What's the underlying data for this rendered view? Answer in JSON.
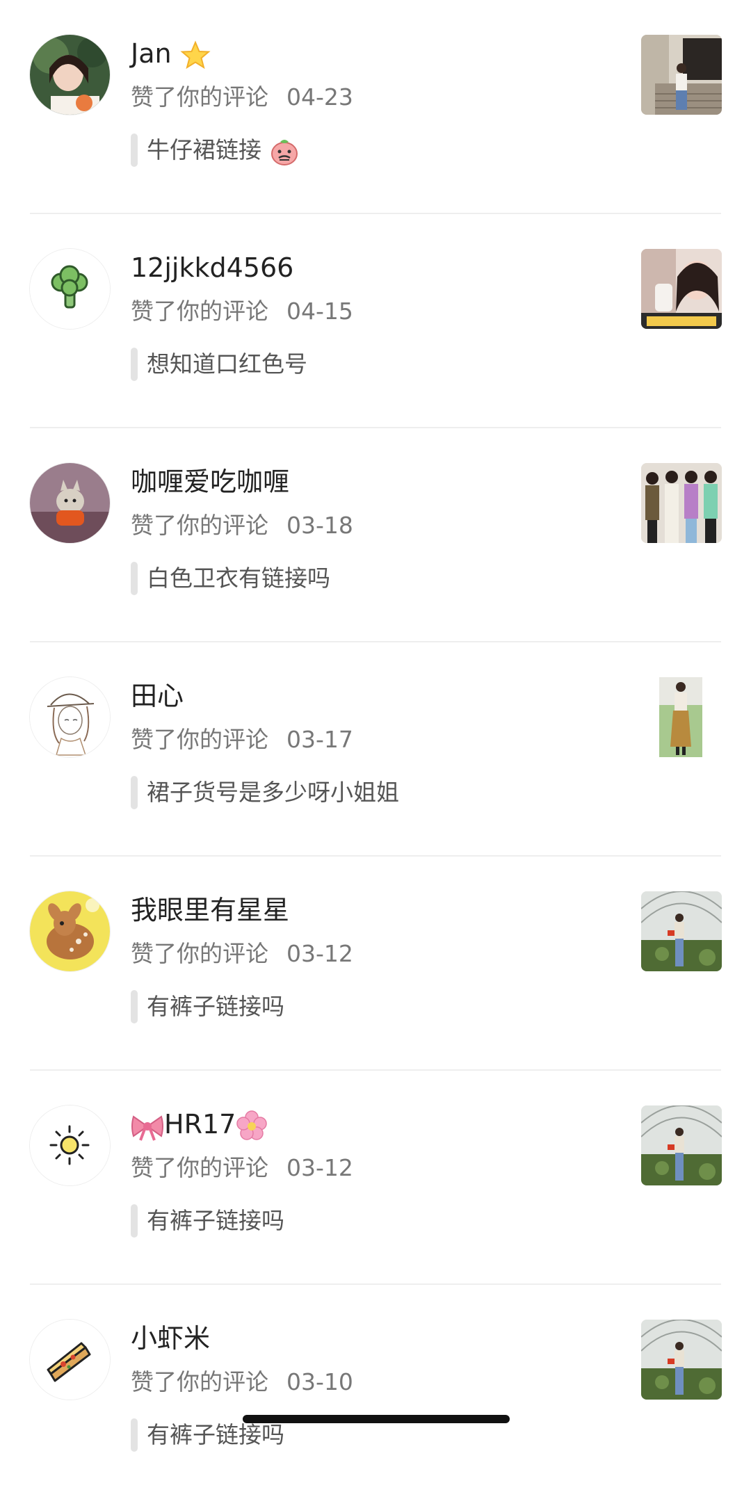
{
  "notifications": [
    {
      "name": "Jan",
      "name_emoji_after": "star-emoji",
      "action": "赞了你的评论",
      "date": "04-23",
      "comment": "牛仔裙链接",
      "comment_emoji": "peach-face-emoji",
      "avatar": "girl-photo-avatar",
      "thumbnail": "storefront-photo"
    },
    {
      "name": "12jjkkd4566",
      "action": "赞了你的评论",
      "date": "04-15",
      "comment": "想知道口红色号",
      "avatar": "broccoli-icon-avatar",
      "thumbnail": "woman-selfie-photo"
    },
    {
      "name": "咖喱爱吃咖喱",
      "action": "赞了你的评论",
      "date": "03-18",
      "comment": "白色卫衣有链接吗",
      "avatar": "cartoon-cat-avatar",
      "thumbnail": "four-women-photo"
    },
    {
      "name": "田心",
      "action": "赞了你的评论",
      "date": "03-17",
      "comment": "裙子货号是多少呀小姐姐",
      "avatar": "sketch-girl-avatar",
      "thumbnail": "woman-dress-photo"
    },
    {
      "name": "我眼里有星星",
      "action": "赞了你的评论",
      "date": "03-12",
      "comment": "有裤子链接吗",
      "avatar": "deer-cartoon-avatar",
      "thumbnail": "greenhouse-photo"
    },
    {
      "name": "HR17",
      "name_emoji_before": "ribbon-emoji",
      "name_emoji_after": "blossom-emoji",
      "action": "赞了你的评论",
      "date": "03-12",
      "comment": "有裤子链接吗",
      "avatar": "sun-icon-avatar",
      "thumbnail": "greenhouse-photo"
    },
    {
      "name": "小虾米",
      "action": "赞了你的评论",
      "date": "03-10",
      "comment": "有裤子链接吗",
      "avatar": "pizza-icon-avatar",
      "thumbnail": "greenhouse-photo"
    }
  ],
  "colors": {
    "background": "#ffffff",
    "name": "#222222",
    "action": "#777777",
    "comment": "#555555",
    "divider": "#eeeeee",
    "comment_bar": "#e3e3e3"
  }
}
